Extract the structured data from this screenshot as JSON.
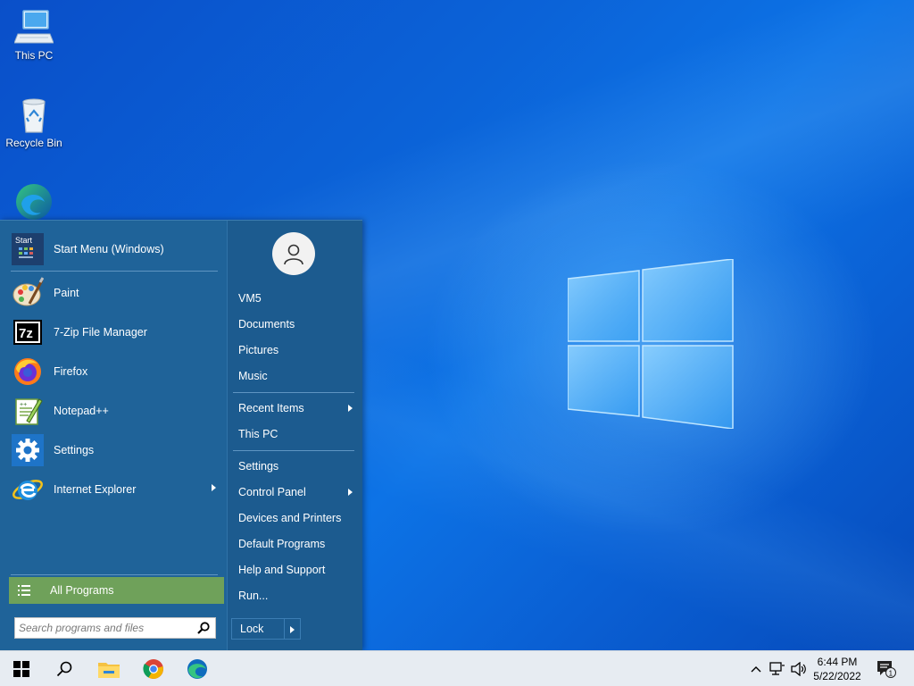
{
  "desktop": {
    "icons": [
      {
        "label": "This PC",
        "icon": "this-pc-icon"
      },
      {
        "label": "Recycle Bin",
        "icon": "recycle-bin-icon"
      },
      {
        "label": "",
        "icon": "edge-icon"
      }
    ]
  },
  "start_menu": {
    "pinned": [
      {
        "label": "Start Menu (Windows)",
        "icon": "start-menu-app-icon"
      },
      {
        "label": "Paint",
        "icon": "paint-icon"
      },
      {
        "label": "7-Zip File Manager",
        "icon": "7zip-icon",
        "icon_text": "7z"
      },
      {
        "label": "Firefox",
        "icon": "firefox-icon"
      },
      {
        "label": "Notepad++",
        "icon": "notepadpp-icon"
      },
      {
        "label": "Settings",
        "icon": "settings-gear-icon"
      },
      {
        "label": "Internet Explorer",
        "icon": "internet-explorer-icon"
      }
    ],
    "start_app_icon_text": "Start",
    "all_programs_label": "All Programs",
    "search": {
      "placeholder": "Search programs and files"
    },
    "right": {
      "user": "VM5",
      "group1": [
        "Documents",
        "Pictures",
        "Music"
      ],
      "recent_items": "Recent Items",
      "this_pc": "This PC",
      "settings": "Settings",
      "control_panel": "Control Panel",
      "devices_printers": "Devices and Printers",
      "default_programs": "Default Programs",
      "help_support": "Help and Support",
      "run": "Run..."
    },
    "lock_label": "Lock"
  },
  "taskbar": {
    "time": "6:44 PM",
    "date": "5/22/2022",
    "notification_count": "1"
  },
  "colors": {
    "menu_bg": "#1d5f94",
    "all_programs_bg": "#6fa15a",
    "taskbar_bg": "#e7ecf2"
  }
}
